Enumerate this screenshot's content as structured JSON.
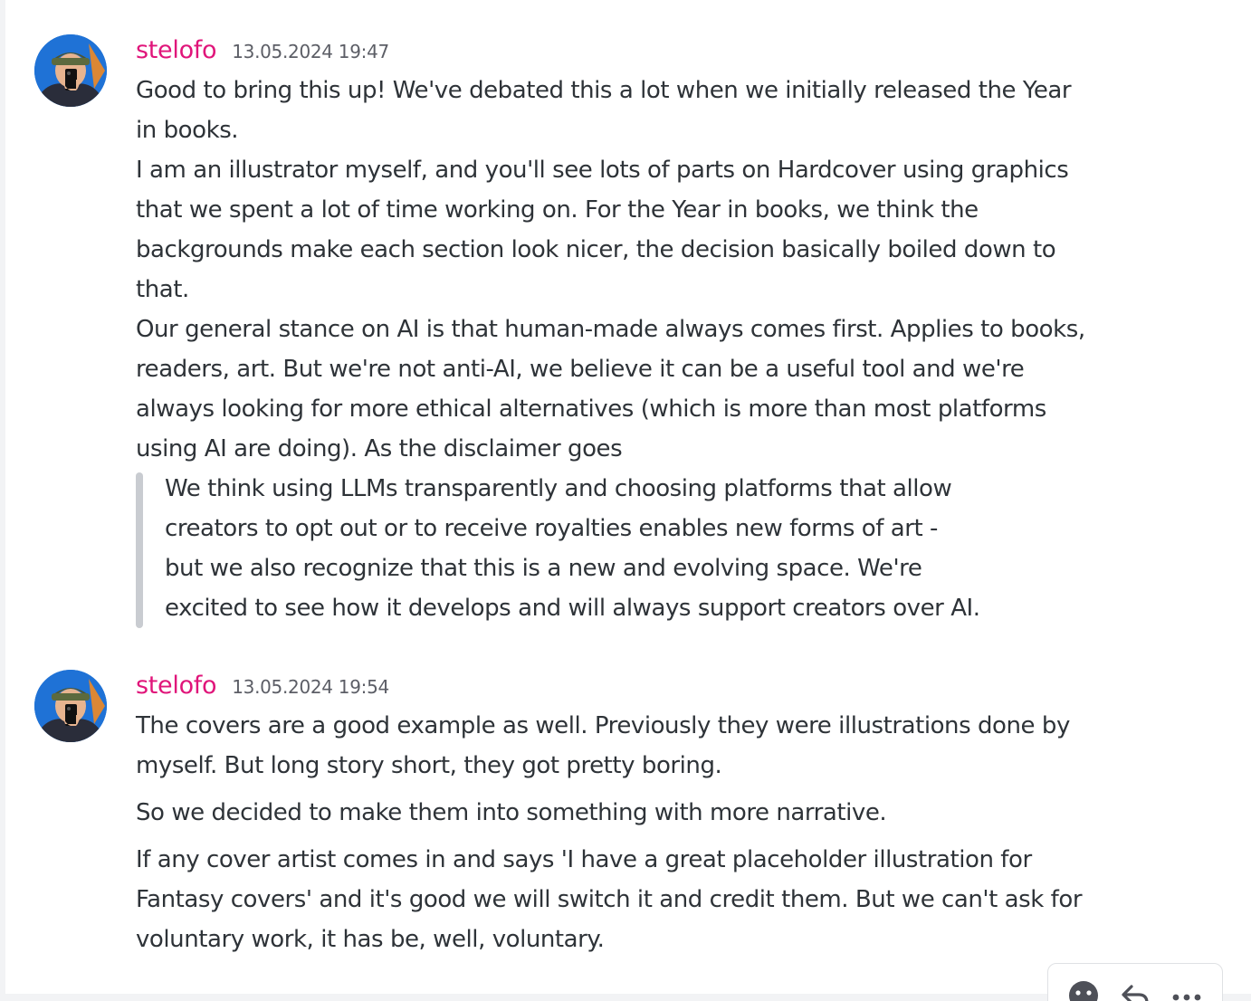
{
  "messages": [
    {
      "username": "stelofo",
      "timestamp": "13.05.2024 19:47",
      "lines": [
        "Good to bring this up! We've debated this a lot when we initially released the Year",
        "in books.",
        "I am an illustrator myself, and you'll see lots of parts on Hardcover using graphics",
        "that we spent a lot of time working on. For the Year in books, we think the",
        "backgrounds make each section look nicer, the decision basically boiled down to",
        "that.",
        "Our general stance on AI is that human-made always comes first. Applies to books,",
        "readers, art. But we're not anti-AI, we believe it can be a useful tool and we're",
        "always looking for more ethical alternatives (which is more than most platforms",
        "using AI are doing). As the disclaimer goes"
      ],
      "quote_lines": [
        "We think using LLMs transparently and choosing platforms that allow",
        "creators to opt out or to receive royalties enables new forms of art -",
        "but we also recognize that this is a new and evolving space. We're",
        "excited to see how it develops and will always support creators over AI."
      ]
    },
    {
      "username": "stelofo",
      "timestamp": "13.05.2024 19:54",
      "paragraphs": [
        [
          "The covers are a good example as well. Previously they were illustrations done by",
          "myself. But long story short, they got pretty boring."
        ],
        [
          "So we decided to make them into something with more narrative."
        ],
        [
          "If any cover artist comes in and says 'I have a great placeholder illustration for",
          "Fantasy covers' and it's good we will switch it and credit them. But we can't ask for",
          "voluntary work, it has be, well, voluntary."
        ]
      ]
    }
  ],
  "toolbar": {
    "icons": [
      "add-reaction-icon",
      "reply-icon",
      "more-icon"
    ]
  },
  "colors": {
    "username": "#e0157a",
    "text": "#2e3338",
    "timestamp": "#5c5e66",
    "quote_bar": "#c9ccd1"
  }
}
